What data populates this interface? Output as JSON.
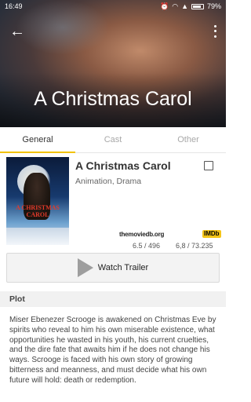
{
  "status_bar": {
    "time": "16:49",
    "battery": "79%"
  },
  "header": {
    "title": "A Christmas Carol"
  },
  "tabs": [
    {
      "label": "General",
      "active": true
    },
    {
      "label": "Cast",
      "active": false
    },
    {
      "label": "Other",
      "active": false
    }
  ],
  "movie": {
    "title": "A Christmas Carol",
    "genres": "Animation, Drama",
    "poster_title": "A CHRISTMAS CAROL",
    "tmdb_logo": "themoviedb.org",
    "tmdb_score": "6.5 / 496",
    "imdb_logo": "IMDb",
    "imdb_score": "6,8 / 73.235",
    "watch_trailer_label": "Watch Trailer"
  },
  "plot": {
    "header": "Plot",
    "text": "Miser Ebenezer Scrooge is awakened on Christmas Eve by spirits who reveal to him his own miserable existence, what opportunities he wasted in his youth, his current cruelties, and the dire fate that awaits him if he does not change his ways. Scrooge is faced with his own story of growing bitterness and meanness, and must decide what his own future will hold: death or redemption."
  },
  "colors": {
    "accent": "#f2c200",
    "imdb_yellow": "#f5c518"
  },
  "icons": [
    "back-arrow-icon",
    "more-vert-icon",
    "wifi-icon",
    "signal-icon",
    "battery-icon",
    "play-icon",
    "checkbox-icon"
  ]
}
